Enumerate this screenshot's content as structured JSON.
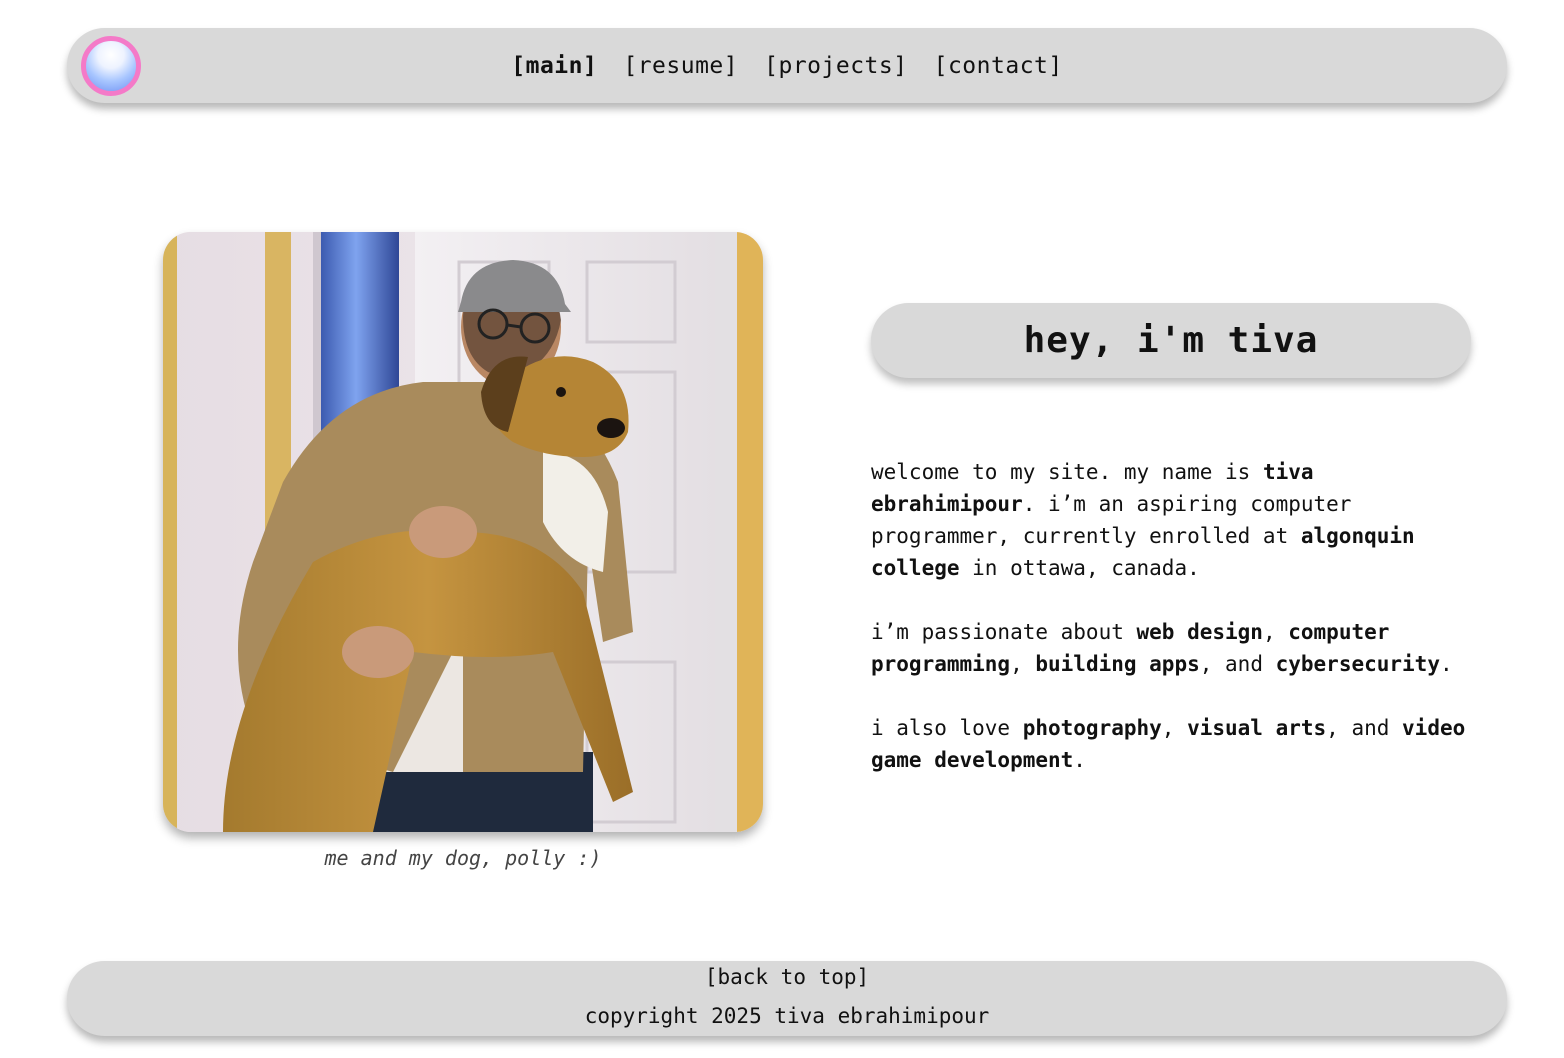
{
  "nav": {
    "logo_icon": "glossy-orb-icon",
    "links": [
      {
        "label": "[main]",
        "active": true
      },
      {
        "label": "[resume]",
        "active": false
      },
      {
        "label": "[projects]",
        "active": false
      },
      {
        "label": "[contact]",
        "active": false
      }
    ]
  },
  "photo": {
    "alt": "me and my dog, polly :)",
    "caption": "me and my dog, polly :)"
  },
  "hero": {
    "title": "hey, i'm tiva"
  },
  "bio": {
    "p1": {
      "t1": "welcome to my site. my name is ",
      "b1": "tiva ebrahimipour",
      "t2": ". i’m an aspiring computer programmer, currently enrolled at ",
      "b2": "algonquin college",
      "t3": " in ottawa, canada."
    },
    "p2": {
      "t1": "i’m passionate about ",
      "b1": "web design",
      "t2": ", ",
      "b2": "computer programming",
      "t3": ", ",
      "b3": "building apps",
      "t4": ", and ",
      "b4": "cybersecurity",
      "t5": "."
    },
    "p3": {
      "t1": "i also love ",
      "b1": "photography",
      "t2": ", ",
      "b2": "visual arts",
      "t3": ", and ",
      "b3": "video game development",
      "t4": "."
    }
  },
  "footer": {
    "back_to_top": "[back to top]",
    "copyright": "copyright 2025 tiva ebrahimipour"
  },
  "colors": {
    "pill_bg": "#d9d9d9",
    "logo_ring": "#f47ac8",
    "text": "#111111"
  }
}
